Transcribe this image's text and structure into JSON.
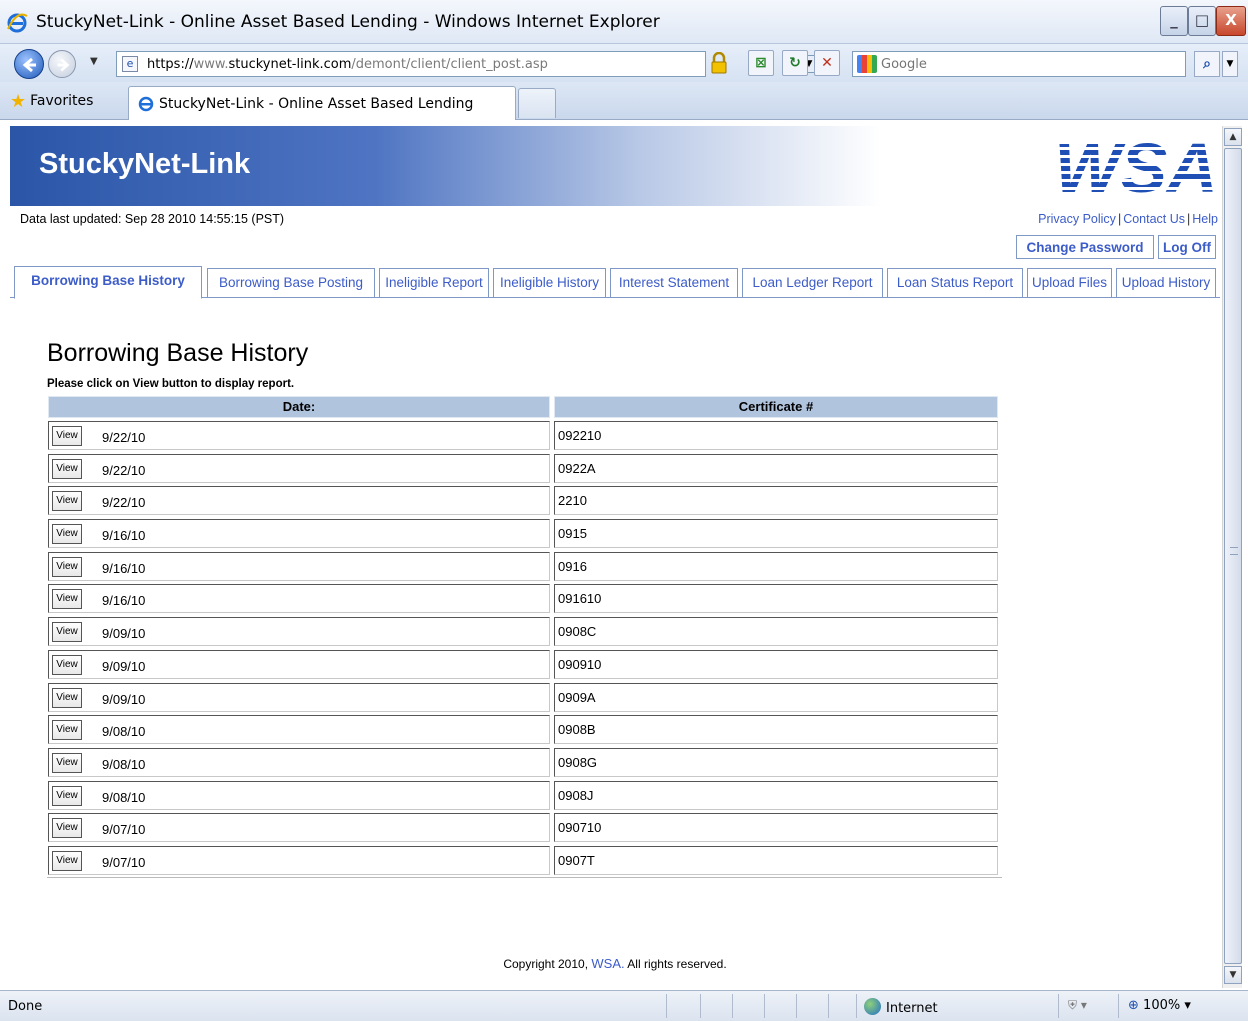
{
  "window": {
    "title": "StuckyNet-Link - Online Asset Based Lending - Windows Internet Explorer",
    "min": "_",
    "max": "□",
    "close": "X"
  },
  "address": {
    "url_prefix": "https://",
    "url_host": "www.",
    "url_domain": "stuckynet-link.com",
    "url_path": "/demont/client/client_post.asp",
    "search_placeholder": "Google"
  },
  "favorites": {
    "label": "Favorites",
    "tab_title": "StuckyNet-Link - Online Asset Based Lending"
  },
  "site": {
    "brand": "StuckyNet-Link",
    "logo_text": "WSA",
    "last_updated": "Data last updated:  Sep 28 2010 14:55:15 (PST)",
    "links": [
      "Privacy Policy",
      "Contact Us",
      "Help"
    ],
    "change_password": "Change Password",
    "log_off": "Log Off"
  },
  "tabs": [
    {
      "label": "Borrowing Base History",
      "active": true
    },
    {
      "label": "Borrowing Base Posting",
      "active": false
    },
    {
      "label": "Ineligible Report",
      "active": false
    },
    {
      "label": "Ineligible History",
      "active": false
    },
    {
      "label": "Interest Statement",
      "active": false
    },
    {
      "label": "Loan Ledger Report",
      "active": false
    },
    {
      "label": "Loan Status Report",
      "active": false
    },
    {
      "label": "Upload Files",
      "active": false
    },
    {
      "label": "Upload History",
      "active": false
    }
  ],
  "content": {
    "heading": "Borrowing Base History",
    "instruction": "Please click on View button to display report.",
    "columns": [
      "Date:",
      "Certificate #"
    ],
    "view_label": "View",
    "rows": [
      {
        "date": "9/22/10",
        "cert": "092210"
      },
      {
        "date": "9/22/10",
        "cert": "0922A"
      },
      {
        "date": "9/22/10",
        "cert": "2210"
      },
      {
        "date": "9/16/10",
        "cert": "0915"
      },
      {
        "date": "9/16/10",
        "cert": "0916"
      },
      {
        "date": "9/16/10",
        "cert": "091610"
      },
      {
        "date": "9/09/10",
        "cert": "0908C"
      },
      {
        "date": "9/09/10",
        "cert": "090910"
      },
      {
        "date": "9/09/10",
        "cert": "0909A"
      },
      {
        "date": "9/08/10",
        "cert": "0908B"
      },
      {
        "date": "9/08/10",
        "cert": "0908G"
      },
      {
        "date": "9/08/10",
        "cert": "0908J"
      },
      {
        "date": "9/07/10",
        "cert": "090710"
      },
      {
        "date": "9/07/10",
        "cert": "0907T"
      }
    ]
  },
  "footer": {
    "copyright_prefix": "Copyright 2010,",
    "company": "WSA.",
    "suffix": "All rights reserved."
  },
  "status": {
    "text": "Done",
    "zone": "Internet",
    "zoom": "100%"
  },
  "colors": {
    "accent": "#3c5cc8",
    "header_blue": "#2b56a8",
    "grid_header": "#b0c4de"
  }
}
